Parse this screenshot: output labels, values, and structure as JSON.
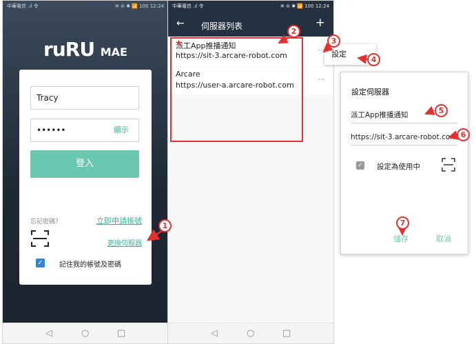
{
  "panel1": {
    "status_left": "中華電信 .ıl 令 ",
    "status_right": "✲ ⊖ ✱ 📶 100 12:24",
    "logo_a": "ruRU",
    "logo_b": "MAE",
    "username_value": "Tracy",
    "password_value": "••••••",
    "show_label": "顯示",
    "login_label": "登入",
    "forgot_label": "忘記密碼？",
    "apply_label": "立即申請帳號",
    "change_server_label": "更換伺服器",
    "remember_label": "記住我的帳號及密碼",
    "checkbox_mark": "✓"
  },
  "panel2": {
    "status_left": "中華電信 .ıl 令 ",
    "status_right": "✲ ⊖ ✱ 📶 100 12:24",
    "title": "伺服器列表",
    "back_glyph": "←",
    "plus_glyph": "+",
    "servers": [
      {
        "name": "派工App推播通知",
        "url": "https://sit-3.arcare-robot.com",
        "menu": "···"
      },
      {
        "name": "Arcare",
        "url": "https://user-a.arcare-robot.com",
        "menu": "···"
      }
    ]
  },
  "popup": {
    "settings_label": "設定"
  },
  "dialog": {
    "title": "設定伺服器",
    "name_value": "派工App推播通知",
    "url_value": "https://sit-3.arcare-robot.com",
    "use_label": "設定為使用中",
    "checkbox_mark": "✓",
    "save_label": "儲存",
    "cancel_label": "取消"
  },
  "annotations": {
    "n1": "1",
    "n2": "2",
    "n3": "3",
    "n4": "4",
    "n5": "5",
    "n6": "6",
    "n7": "7",
    "star": "★",
    "color": "#e53030"
  },
  "nav": {
    "back": "◁",
    "home": "○",
    "recent": "□"
  }
}
